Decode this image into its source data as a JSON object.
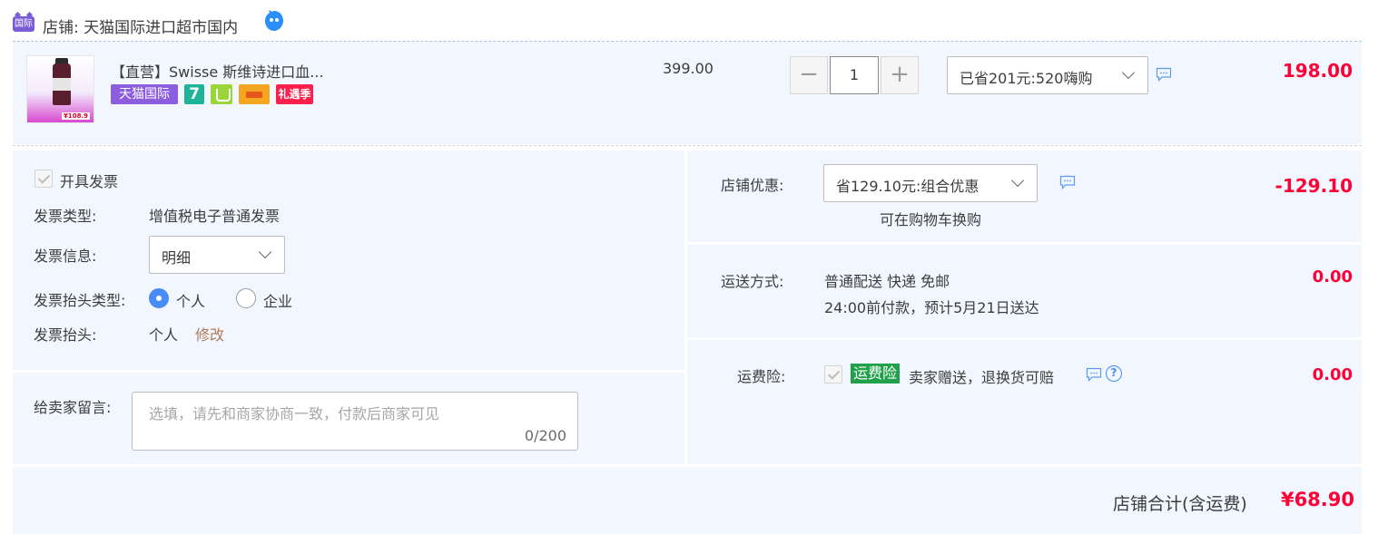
{
  "store": {
    "badge": "国际",
    "name": "店铺: 天猫国际进口超市国内"
  },
  "item": {
    "title": "【直营】Swisse 斯维诗进口血...",
    "thumb_price": "¥108.9",
    "badges": {
      "tmall": "天猫国际",
      "seven": "7",
      "gift": "礼遇季"
    },
    "unit_price": "399.00",
    "quantity": "1",
    "promo_select": "已省201元:520嗨购",
    "total": "198.00"
  },
  "invoice": {
    "open_label": "开具发票",
    "type_label": "发票类型:",
    "type_value": "增值税电子普通发票",
    "info_label": "发票信息:",
    "info_value": "明细",
    "title_type_label": "发票抬头类型:",
    "title_type_options": [
      "个人",
      "企业"
    ],
    "title_type_selected": "个人",
    "title_label": "发票抬头:",
    "title_value": "个人",
    "edit_label": "修改"
  },
  "message": {
    "label": "给卖家留言:",
    "placeholder": "选填，请先和商家协商一致，付款后商家可见",
    "counter": "0/200"
  },
  "store_discount": {
    "label": "店铺优惠:",
    "select_value": "省129.10元:组合优惠",
    "note": "可在购物车换购",
    "amount": "-129.10"
  },
  "shipping": {
    "label": "运送方式:",
    "method": "普通配送 快递 免邮",
    "eta": "24:00前付款，预计5月21日送达",
    "amount": "0.00"
  },
  "insurance": {
    "label": "运费险:",
    "tag": "运费险",
    "description": "卖家赠送，退换货可赔",
    "help": "?",
    "amount": "0.00"
  },
  "footer": {
    "label": "店铺合计(含运费)",
    "total": "¥68.90"
  },
  "colors": {
    "accent_red": "#ff0036",
    "panel_bg": "#f2f7ff",
    "radio_blue": "#4a8cf7",
    "insurance_green": "#21a04a",
    "edit_link": "#b07a57"
  }
}
